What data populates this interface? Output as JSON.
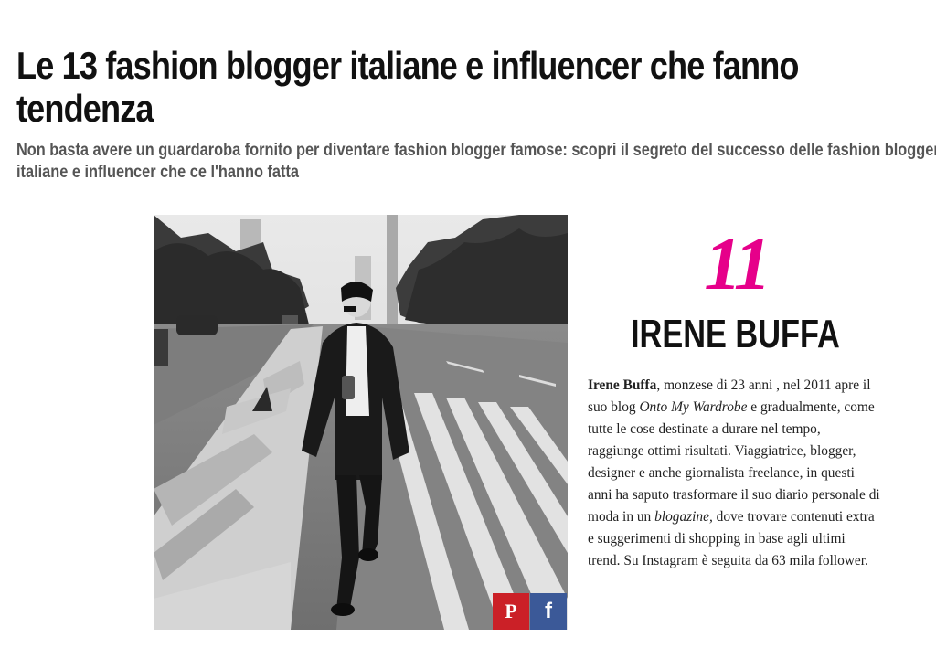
{
  "article": {
    "title": "Le 13 fashion blogger italiane e influencer che fanno tendenza",
    "subtitle": "Non basta avere un guardaroba fornito per diventare fashion blogger famose: scopri il segreto del successo delle fashion blogger italiane e influencer che ce l'hanno fatta"
  },
  "entry": {
    "number": "11",
    "name": "IRENE BUFFA",
    "bio": {
      "name_bold": "Irene Buffa",
      "part1": ", monzese di 23 anni , nel 2011 apre il suo blog ",
      "blog_italic": "Onto My Wardrobe",
      "part2": " e gradualmente, come tutte le cose destinate a durare nel tempo, raggiunge ottimi risultati. Viaggiatrice, blogger, designer e anche giornalista freelance, in questi anni ha saputo trasformare il suo diario personale di moda in un ",
      "blogazine_italic": "blogazine,",
      "part3": " dove trovare contenuti extra e suggerimenti di shopping in base agli ultimi trend. Su Instagram è seguita da 63 mila follower."
    }
  },
  "share": {
    "pinterest_glyph": "P",
    "facebook_glyph": "f"
  },
  "colors": {
    "accent": "#e6008a",
    "pinterest": "#cb2027",
    "facebook": "#3b5998"
  }
}
